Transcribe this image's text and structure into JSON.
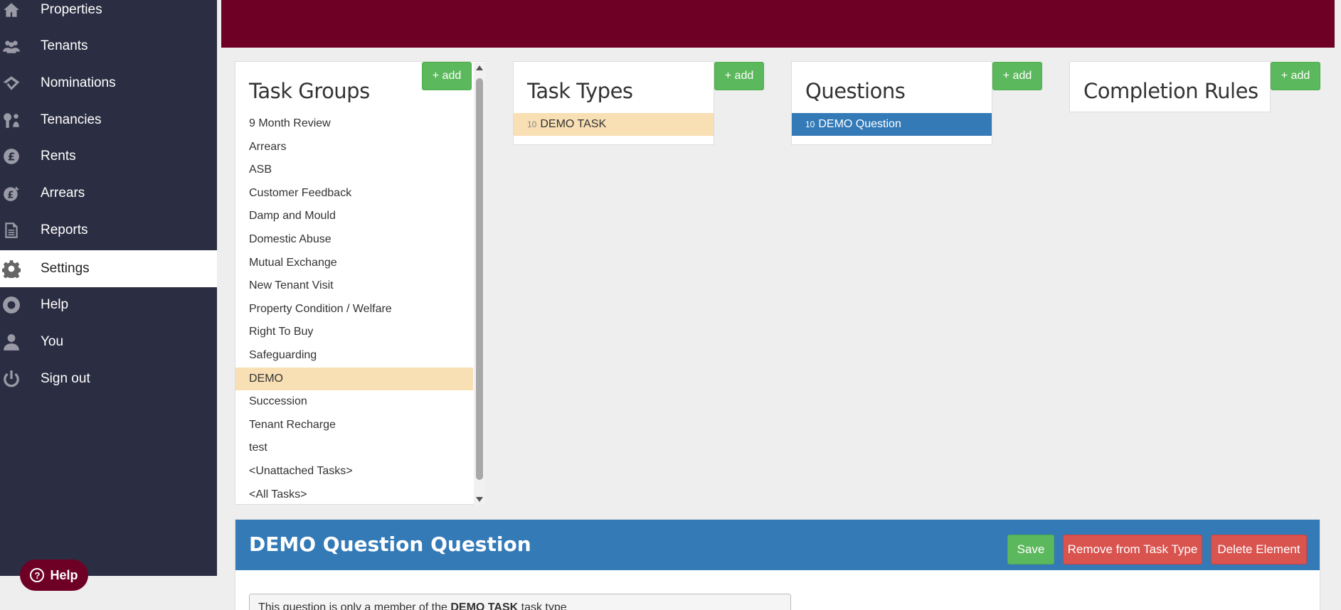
{
  "sidebar": {
    "items": [
      {
        "label": "Properties",
        "icon": "home-icon"
      },
      {
        "label": "Tenants",
        "icon": "users-icon"
      },
      {
        "label": "Nominations",
        "icon": "nominations-icon"
      },
      {
        "label": "Tenancies",
        "icon": "key-icon"
      },
      {
        "label": "Rents",
        "icon": "pound-icon"
      },
      {
        "label": "Arrears",
        "icon": "arrears-icon"
      },
      {
        "label": "Reports",
        "icon": "document-icon"
      },
      {
        "label": "Settings",
        "icon": "gear-icon",
        "active": true
      },
      {
        "label": "Help",
        "icon": "lifebuoy-icon"
      },
      {
        "label": "You",
        "icon": "user-icon"
      },
      {
        "label": "Sign out",
        "icon": "power-icon"
      }
    ]
  },
  "help_pill": {
    "label": "Help"
  },
  "task_groups": {
    "title": "Task Groups",
    "add_label": "+ add",
    "items": [
      "9 Month Review",
      "Arrears",
      "ASB",
      "Customer Feedback",
      "Damp and Mould",
      "Domestic Abuse",
      "Mutual Exchange",
      "New Tenant Visit",
      "Property Condition / Welfare",
      "Right To Buy",
      "Safeguarding",
      "DEMO",
      "Succession",
      "Tenant Recharge",
      "test",
      "<Unattached Tasks>",
      "<All Tasks>"
    ],
    "selected": "DEMO"
  },
  "task_types": {
    "title": "Task Types",
    "add_label": "+ add",
    "items": [
      {
        "num": "10",
        "label": "DEMO TASK"
      }
    ]
  },
  "questions": {
    "title": "Questions",
    "add_label": "+ add",
    "items": [
      {
        "num": "10",
        "label": "DEMO Question"
      }
    ]
  },
  "completion_rules": {
    "title": "Completion Rules",
    "add_label": "+ add"
  },
  "question_panel": {
    "title": "DEMO Question Question",
    "save_label": "Save",
    "remove_label": "Remove from Task Type",
    "delete_label": "Delete Element",
    "info_prefix": "This question is only a member of the ",
    "info_bold": "DEMO TASK",
    "info_suffix": " task type"
  },
  "colors": {
    "sidebar_bg": "#2b2d42",
    "banner_bg": "#6e0026",
    "add_green": "#5cb85c",
    "selected_tan": "#f8dfb4",
    "selected_blue": "#337ab7",
    "danger_red": "#d9534f"
  }
}
